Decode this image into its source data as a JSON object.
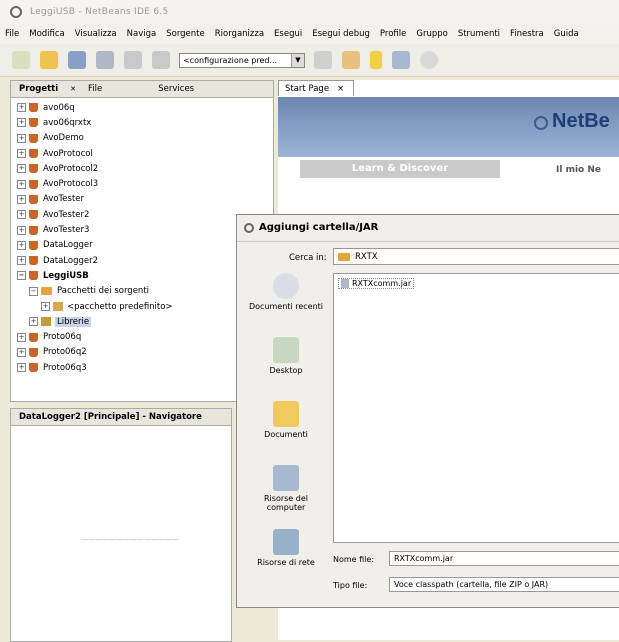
{
  "window": {
    "title": "LeggiUSB - NetBeans IDE 6.5"
  },
  "menu": [
    "File",
    "Modifica",
    "Visualizza",
    "Naviga",
    "Sorgente",
    "Riorganizza",
    "Esegui",
    "Esegui debug",
    "Profile",
    "Gruppo",
    "Strumenti",
    "Finestra",
    "Guida"
  ],
  "toolbar": {
    "config_select": "<configurazione pred..."
  },
  "projects_panel": {
    "tabs": [
      "Progetti",
      "File",
      "Services"
    ],
    "tree": [
      {
        "label": "avo06q",
        "depth": 0,
        "icon": "cup"
      },
      {
        "label": "avo06qrxtx",
        "depth": 0,
        "icon": "cup"
      },
      {
        "label": "AvoDemo",
        "depth": 0,
        "icon": "cup"
      },
      {
        "label": "AvoProtocol",
        "depth": 0,
        "icon": "cup"
      },
      {
        "label": "AvoProtocol2",
        "depth": 0,
        "icon": "cup"
      },
      {
        "label": "AvoProtocol3",
        "depth": 0,
        "icon": "cup"
      },
      {
        "label": "AvoTester",
        "depth": 0,
        "icon": "cup"
      },
      {
        "label": "AvoTester2",
        "depth": 0,
        "icon": "cup"
      },
      {
        "label": "AvoTester3",
        "depth": 0,
        "icon": "cup"
      },
      {
        "label": "DataLogger",
        "depth": 0,
        "icon": "cup"
      },
      {
        "label": "DataLogger2",
        "depth": 0,
        "icon": "cup"
      },
      {
        "label": "LeggiUSB",
        "depth": 0,
        "icon": "cup",
        "bold": true,
        "expanded": true
      },
      {
        "label": "Pacchetti dei sorgenti",
        "depth": 1,
        "icon": "folder",
        "expanded": true
      },
      {
        "label": "<pacchetto predefinito>",
        "depth": 2,
        "icon": "package"
      },
      {
        "label": "Librerie",
        "depth": 1,
        "icon": "library",
        "selected": true
      },
      {
        "label": "Proto06q",
        "depth": 0,
        "icon": "cup"
      },
      {
        "label": "Proto06q2",
        "depth": 0,
        "icon": "cup"
      },
      {
        "label": "Proto06q3",
        "depth": 0,
        "icon": "cup"
      }
    ]
  },
  "navigator": {
    "title": "DataLogger2 [Principale] - Navigatore"
  },
  "editor": {
    "tab_label": "Start Page",
    "learn_label": "Learn & Discover",
    "my_netbeans_label": "Il mio Ne",
    "logo_text": "NetBe"
  },
  "dialog": {
    "title": "Aggiungi cartella/JAR",
    "look_in_label": "Cerca in:",
    "look_in_value": "RXTX",
    "places": [
      "Documenti recenti",
      "Desktop",
      "Documenti",
      "Risorse del computer",
      "Risorse di rete"
    ],
    "files": [
      "RXTXcomm.jar"
    ],
    "file_name_label": "Nome file:",
    "file_name_value": "RXTXcomm.jar",
    "file_type_label": "Tipo file:",
    "file_type_value": "Voce classpath (cartella, file ZIP o JAR)"
  }
}
